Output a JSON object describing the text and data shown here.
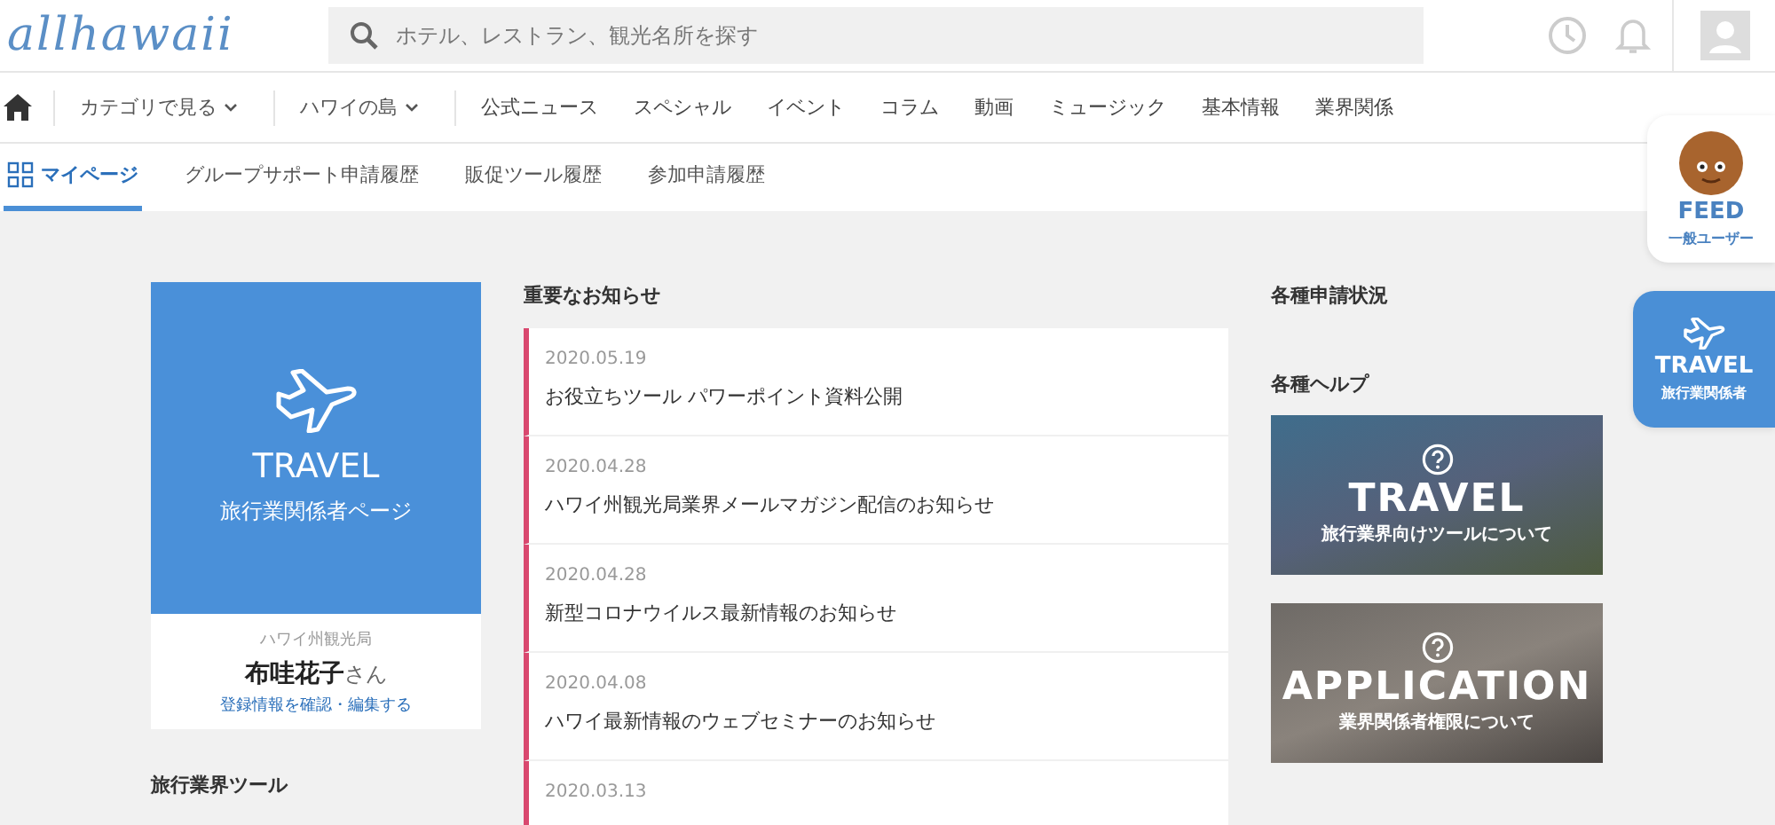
{
  "header": {
    "logo": "allhawaii",
    "search": {
      "placeholder": "ホテル、レストラン、観光名所を探す"
    }
  },
  "nav": [
    {
      "label": "カテゴリで見る",
      "dropdown": true
    },
    {
      "label": "ハワイの島",
      "dropdown": true
    },
    {
      "label": "公式ニュース",
      "dropdown": false
    },
    {
      "label": "スペシャル",
      "dropdown": false
    },
    {
      "label": "イベント",
      "dropdown": false
    },
    {
      "label": "コラム",
      "dropdown": false
    },
    {
      "label": "動画",
      "dropdown": false
    },
    {
      "label": "ミュージック",
      "dropdown": false
    },
    {
      "label": "基本情報",
      "dropdown": false
    },
    {
      "label": "業界関係",
      "dropdown": false
    }
  ],
  "tabs": [
    {
      "label": "マイページ",
      "selected": true
    },
    {
      "label": "グループサポート申請履歴",
      "selected": false
    },
    {
      "label": "販促ツール履歴",
      "selected": false
    },
    {
      "label": "参加申請履歴",
      "selected": false
    }
  ],
  "profile": {
    "title": "TRAVEL",
    "subtitle": "旅行業関係者ページ",
    "organization": "ハワイ州観光局",
    "name": "布哇花子",
    "honorific": "さん",
    "edit_link": "登録情報を確認・編集する"
  },
  "tools_heading": "旅行業界ツール",
  "news": {
    "heading": "重要なお知らせ",
    "items": [
      {
        "date": "2020.05.19",
        "title": "お役立ちツール パワーポイント資料公開"
      },
      {
        "date": "2020.04.28",
        "title": "ハワイ州観光局業界メールマガジン配信のお知らせ"
      },
      {
        "date": "2020.04.28",
        "title": "新型コロナウイルス最新情報のお知らせ"
      },
      {
        "date": "2020.04.08",
        "title": "ハワイ最新情報のウェブセミナーのお知らせ"
      },
      {
        "date": "2020.03.13"
      }
    ]
  },
  "status_heading": "各種申請状況",
  "help": {
    "heading": "各種ヘルプ",
    "banners": [
      {
        "kind": "city",
        "title": "TRAVEL",
        "caption": "旅行業界向けツールについて"
      },
      {
        "kind": "desk",
        "title": "APPLICATION",
        "caption": "業界関係者権限について"
      }
    ]
  },
  "switcher": [
    {
      "kind": "feed",
      "title": "FEED",
      "subtitle": "一般ユーザー",
      "selected": false
    },
    {
      "kind": "travel",
      "title": "TRAVEL",
      "subtitle": "旅行業関係者",
      "selected": true
    }
  ]
}
